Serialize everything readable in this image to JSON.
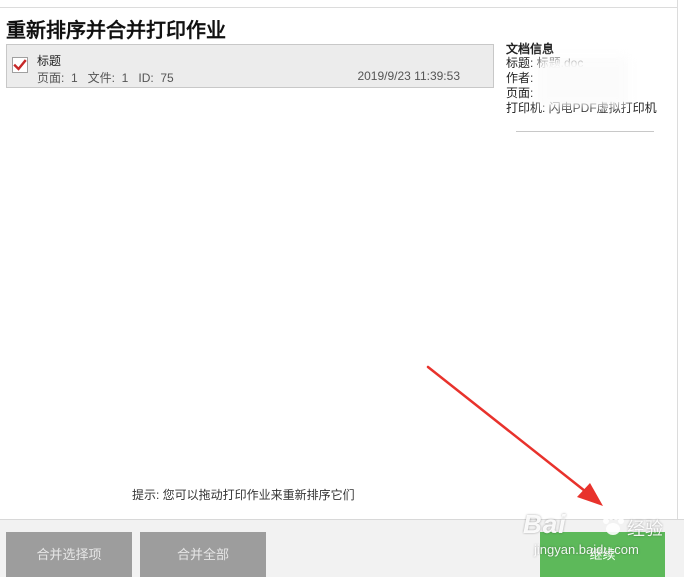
{
  "window": {
    "title": "重新排序并合并打印作业"
  },
  "jobs": [
    {
      "checked": true,
      "name": "标题",
      "meta": "页面:  1   文件:  1   ID:  75",
      "time": "2019/9/23 11:39:53"
    }
  ],
  "doc_info": {
    "heading": "文档信息",
    "title_row": "标题:  标题.doc",
    "author_row": "作者:",
    "pages_row": "页面:",
    "printer_row": "打印机:  闪电PDF虚拟打印机"
  },
  "hint": "提示:  您可以拖动打印作业来重新排序它们",
  "buttons": {
    "merge_selected": "合并选择项",
    "merge_all": "合并全部",
    "continue": "继续"
  },
  "watermark": {
    "logo": "Bai",
    "cn": "经验",
    "url": "jingyan.baidu.com"
  },
  "colors": {
    "checkmark": "#c62828",
    "continue_button": "#5db95a",
    "disabled_button": "#9d9d9d",
    "annotation_arrow": "#e8322c"
  },
  "icons": {
    "checkbox": "checkmark-icon",
    "annotation": "red-arrow-icon"
  }
}
